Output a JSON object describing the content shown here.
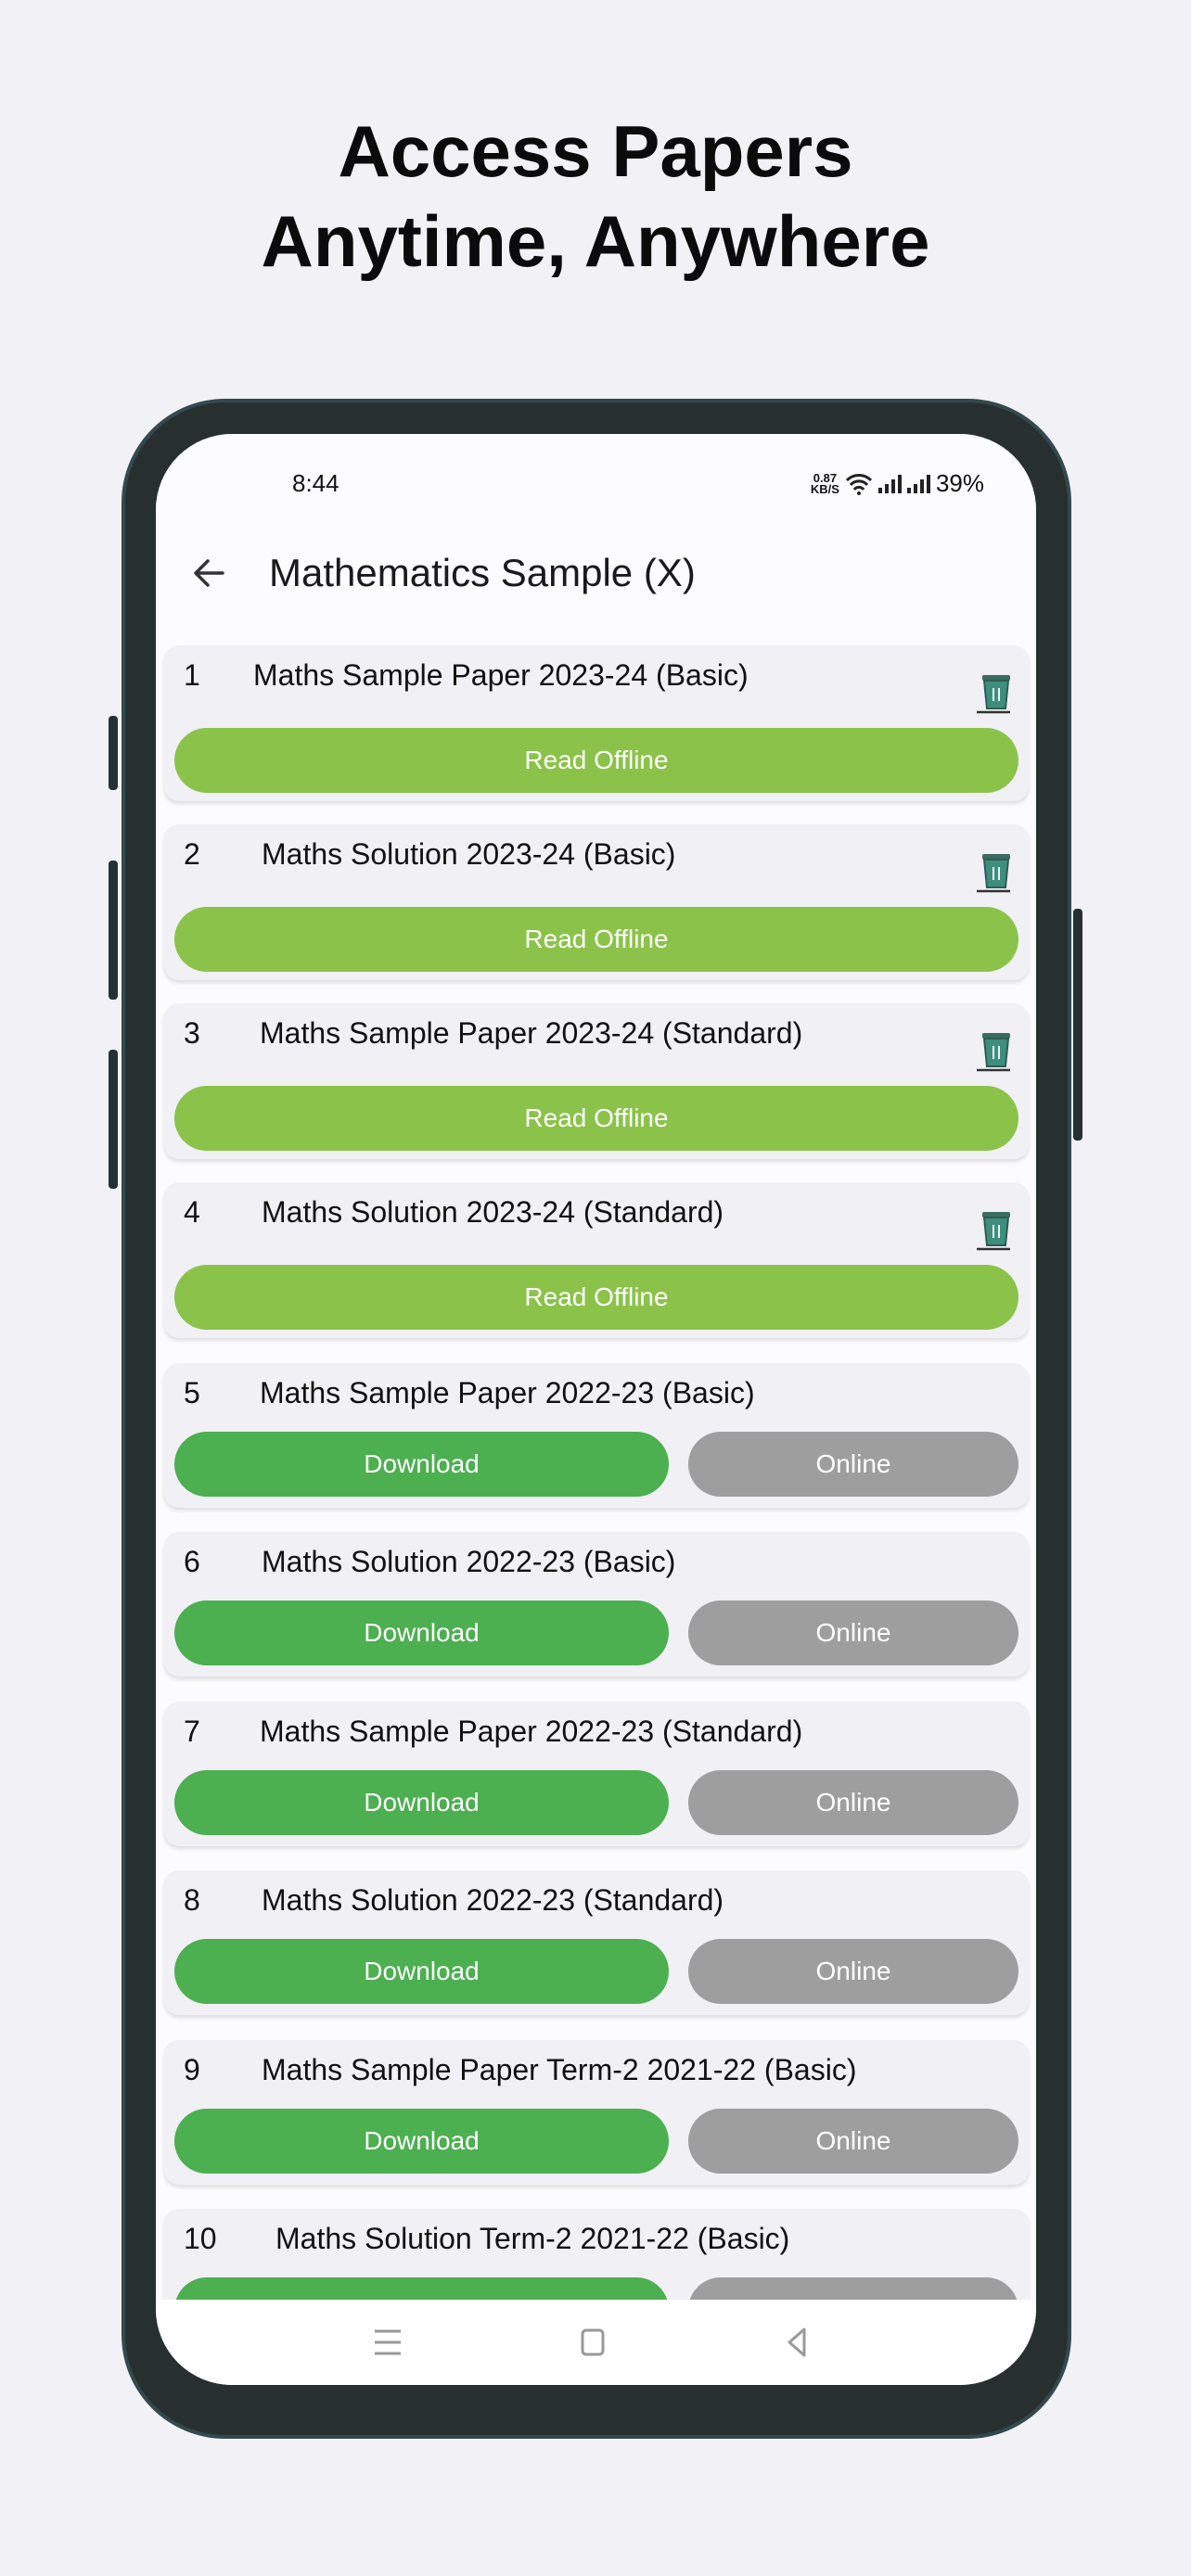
{
  "headline": {
    "line1": "Access Papers",
    "line2": "Anytime, Anywhere"
  },
  "status_bar": {
    "time": "8:44",
    "speed_value": "0.87",
    "speed_unit": "KB/S",
    "battery": "39%"
  },
  "app_bar": {
    "title": "Mathematics Sample (X)"
  },
  "colors": {
    "read_offline": "#8BC34A",
    "download": "#4CAF50",
    "online": "#9E9E9E",
    "card": "#F1F0F5",
    "trash": "#3E8E7E"
  },
  "papers": [
    {
      "num": "1",
      "title": "Maths Sample Paper 2023-24 (Basic)",
      "downloaded": true,
      "primary_label": "Read Offline"
    },
    {
      "num": "2",
      "title": "Maths Solution 2023-24 (Basic)",
      "downloaded": true,
      "primary_label": "Read Offline"
    },
    {
      "num": "3",
      "title": "Maths Sample Paper 2023-24 (Standard)",
      "downloaded": true,
      "primary_label": "Read Offline"
    },
    {
      "num": "4",
      "title": "Maths Solution 2023-24 (Standard)",
      "downloaded": true,
      "primary_label": "Read Offline"
    },
    {
      "num": "5",
      "title": "Maths Sample Paper 2022-23 (Basic)",
      "downloaded": false,
      "primary_label": "Download",
      "secondary_label": "Online"
    },
    {
      "num": "6",
      "title": "Maths Solution 2022-23 (Basic)",
      "downloaded": false,
      "primary_label": "Download",
      "secondary_label": "Online"
    },
    {
      "num": "7",
      "title": "Maths Sample Paper 2022-23 (Standard)",
      "downloaded": false,
      "primary_label": "Download",
      "secondary_label": "Online"
    },
    {
      "num": "8",
      "title": "Maths Solution 2022-23 (Standard)",
      "downloaded": false,
      "primary_label": "Download",
      "secondary_label": "Online"
    },
    {
      "num": "9",
      "title": "Maths Sample Paper Term-2 2021-22 (Basic)",
      "downloaded": false,
      "primary_label": "Download",
      "secondary_label": "Online"
    },
    {
      "num": "10",
      "title": "Maths Solution Term-2 2021-22 (Basic)",
      "downloaded": false,
      "primary_label": "",
      "secondary_label": ""
    }
  ],
  "nav_bar": {
    "icons": [
      "menu-icon",
      "home-square-icon",
      "back-triangle-icon"
    ]
  }
}
